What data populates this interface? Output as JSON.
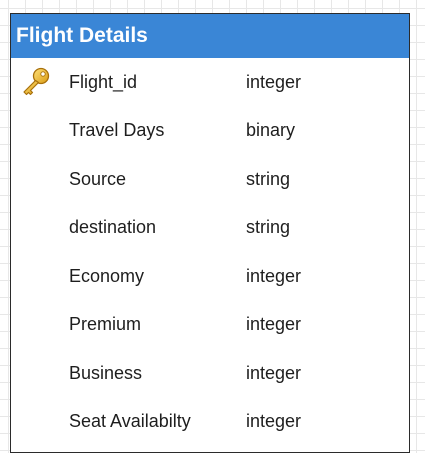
{
  "entity": {
    "title": "Flight Details",
    "header_color": "#3a86d6",
    "fields": [
      {
        "name": "Flight_id",
        "type": "integer",
        "icon": "key-icon"
      },
      {
        "name": "Travel Days",
        "type": "binary"
      },
      {
        "name": "Source",
        "type": "string"
      },
      {
        "name": "destination",
        "type": "string"
      },
      {
        "name": "Economy",
        "type": "integer"
      },
      {
        "name": "Premium",
        "type": "integer"
      },
      {
        "name": "Business",
        "type": "integer"
      },
      {
        "name": "Seat Availabilty",
        "type": "integer"
      }
    ]
  }
}
